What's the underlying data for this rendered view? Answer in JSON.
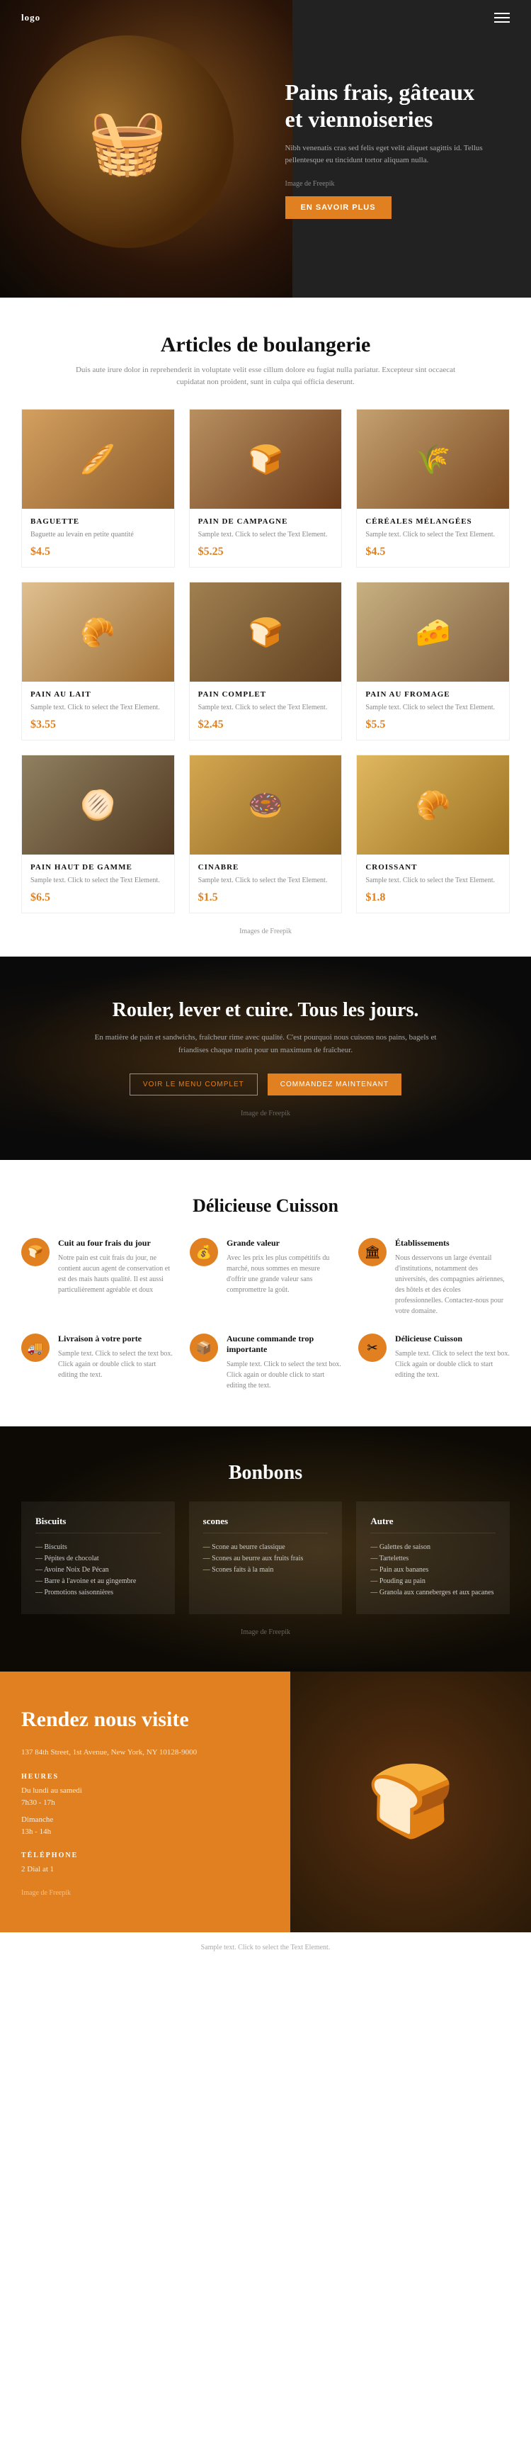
{
  "navbar": {
    "logo": "logo",
    "menu_icon": "≡"
  },
  "hero": {
    "title": "Pains frais, gâteaux et viennoiseries",
    "description": "Nibh venenatis cras sed felis eget velit aliquet sagittis id. Tellus pellentesque eu tincidunt tortor aliquam nulla.",
    "image_credit": "Image de Freepik",
    "btn_label": "EN SAVOIR PLUS"
  },
  "articles": {
    "title": "Articles de boulangerie",
    "subtitle": "Duis aute irure dolor in reprehenderit in voluptate velit esse cillum dolore eu fugiat nulla pariatur. Excepteur sint occaecat cupidatat non proident, sunt in culpa qui officia deserunt.",
    "image_credit": "Images de Freepik",
    "products": [
      {
        "name": "BAGUETTE",
        "description": "Baguette au levain en petite quantité",
        "price": "$4.5",
        "emoji": "🥖"
      },
      {
        "name": "PAIN DE CAMPAGNE",
        "description": "Sample text. Click to select the Text Element.",
        "price": "$5.25",
        "emoji": "🍞"
      },
      {
        "name": "CÉRÉALES MÉLANGÉES",
        "description": "Sample text. Click to select the Text Element.",
        "price": "$4.5",
        "emoji": "🌾"
      },
      {
        "name": "PAIN AU LAIT",
        "description": "Sample text. Click to select the Text Element.",
        "price": "$3.55",
        "emoji": "🥐"
      },
      {
        "name": "PAIN COMPLET",
        "description": "Sample text. Click to select the Text Element.",
        "price": "$2.45",
        "emoji": "🍞"
      },
      {
        "name": "PAIN AU FROMAGE",
        "description": "Sample text. Click to select the Text Element.",
        "price": "$5.5",
        "emoji": "🧀"
      },
      {
        "name": "PAIN HAUT DE GAMME",
        "description": "Sample text. Click to select the Text Element.",
        "price": "$6.5",
        "emoji": "🫓"
      },
      {
        "name": "CINABRE",
        "description": "Sample text. Click to select the Text Element.",
        "price": "$1.5",
        "emoji": "🍩"
      },
      {
        "name": "CROISSANT",
        "description": "Sample text. Click to select the Text Element.",
        "price": "$1.8",
        "emoji": "🥐"
      }
    ]
  },
  "banner": {
    "title": "Rouler, lever et cuire. Tous les jours.",
    "description": "En matière de pain et sandwichs, fraîcheur rime avec qualité. C'est pourquoi nous cuisons nos pains, bagels et friandises chaque matin pour un maximum de fraîcheur.",
    "btn1": "VOIR LE MENU COMPLET",
    "btn2": "COMMANDEZ MAINTENANT",
    "image_credit": "Image de Freepik"
  },
  "features": {
    "title": "Délicieuse Cuisson",
    "items": [
      {
        "icon": "🍞",
        "title": "Cuit au four frais du jour",
        "description": "Notre pain est cuit frais du jour, ne contient aucun agent de conservation et est des mais hauts qualité. Il est aussi particulièrement agréable et doux"
      },
      {
        "icon": "💰",
        "title": "Grande valeur",
        "description": "Avec les prix les plus compétitifs du marché, nous sommes en mesure d'offrir une grande valeur sans compromettre la goût."
      },
      {
        "icon": "🏛",
        "title": "Établissements",
        "description": "Nous desservons un large éventail d'institutions, notamment des universités, des compagnies aériennes, des hôtels et des écoles professionnelles. Contactez-nous pour votre domaine."
      },
      {
        "icon": "🚚",
        "title": "Livraison à votre porte",
        "description": "Sample text. Click to select the text box. Click again or double click to start editing the text."
      },
      {
        "icon": "📦",
        "title": "Aucune commande trop importante",
        "description": "Sample text. Click to select the text box. Click again or double click to start editing the text."
      },
      {
        "icon": "✂",
        "title": "Délicieuse Cuisson",
        "description": "Sample text. Click to select the text box. Click again or double click to start editing the text."
      }
    ]
  },
  "bonbons": {
    "title": "Bonbons",
    "image_credit": "Image de Freepik",
    "columns": [
      {
        "title": "Biscuits",
        "items": [
          "Biscuits",
          "Pépites de chocolat",
          "Avoine Noix De Pécan",
          "Barre à l'avoine et au gingembre",
          "Promotions saisonnières"
        ]
      },
      {
        "title": "scones",
        "items": [
          "Scone au beurre classique",
          "Scones au beurre aux fruits frais",
          "Scones faits à la main"
        ]
      },
      {
        "title": "Autre",
        "items": [
          "Galettes de saison",
          "Tartelettes",
          "Pain aux bananes",
          "Pouding au pain",
          "Granola aux canneberges et aux pacanes"
        ]
      }
    ]
  },
  "visit": {
    "title": "Rendez nous visite",
    "address": "137 84th Street, 1st Avenue, New York, NY 10128-9000",
    "hours_label": "HEURES",
    "hours_weekday": "Du lundi au samedi\n7h30 - 17h",
    "hours_sunday": "Dimanche\n13h - 14h",
    "phone_label": "TÉLÉPHONE",
    "phone": "2 Dial at 1",
    "image_credit": "Image de Freepik"
  },
  "footer": {
    "note": "Sample text. Click to select the Text Element."
  }
}
